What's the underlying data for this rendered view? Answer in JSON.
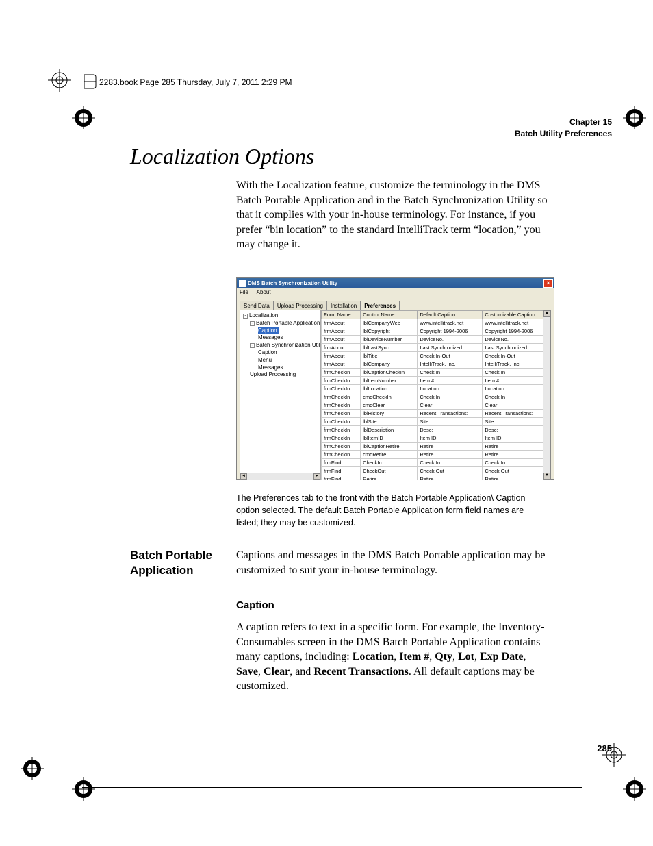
{
  "bookline": "2283.book  Page 285  Thursday, July 7, 2011  2:29 PM",
  "header": {
    "chapter": "Chapter 15",
    "title": "Batch Utility Preferences"
  },
  "h1": "Localization Options",
  "para1": "With the Localization feature, customize the terminology in the DMS Batch Portable Application and in the Batch Synchronization Utility so that it complies with your in-house terminology. For instance, if you prefer “bin location” to the standard IntelliTrack term “location,” you may change it.",
  "app": {
    "title": "DMS Batch Synchronization Utility",
    "menu": [
      "File",
      "About"
    ],
    "tabs": [
      "Send Data",
      "Upload Processing",
      "Installation",
      "Preferences"
    ],
    "active_tab": 3,
    "tree": [
      {
        "lvl": 0,
        "exp": "-",
        "label": "Localization"
      },
      {
        "lvl": 1,
        "exp": "-",
        "label": "Batch Portable Application"
      },
      {
        "lvl": 2,
        "label": "Caption",
        "selected": true
      },
      {
        "lvl": 2,
        "label": "Messages"
      },
      {
        "lvl": 1,
        "exp": "-",
        "label": "Batch Synchronization Utility"
      },
      {
        "lvl": 2,
        "label": "Caption"
      },
      {
        "lvl": 2,
        "label": "Menu"
      },
      {
        "lvl": 2,
        "label": "Messages"
      },
      {
        "lvl": 1,
        "label": "Upload Processing"
      }
    ],
    "columns": [
      "Form Name",
      "Control Name",
      "Default Caption",
      "Customizable Caption"
    ],
    "rows": [
      [
        "frmAbout",
        "lblCompanyWeb",
        "www.intellitrack.net",
        "www.intellitrack.net"
      ],
      [
        "frmAbout",
        "lblCopyright",
        "Copyright 1994-2006",
        "Copyright 1994-2006"
      ],
      [
        "frmAbout",
        "lblDeviceNumber",
        "DeviceNo.",
        "DeviceNo."
      ],
      [
        "frmAbout",
        "lblLastSync",
        "Last Synchronized:",
        "Last Synchronized:"
      ],
      [
        "frmAbout",
        "lblTitle",
        "Check In-Out",
        "Check In-Out"
      ],
      [
        "frmAbout",
        "lblCompany",
        "IntelliTrack, Inc.",
        "IntelliTrack, Inc."
      ],
      [
        "frmCheckIn",
        "lblCaptionCheckIn",
        "Check In",
        "Check In"
      ],
      [
        "frmCheckIn",
        "lblItemNumber",
        "Item #:",
        "Item #:"
      ],
      [
        "frmCheckIn",
        "lblLocation",
        "Location:",
        "Location:"
      ],
      [
        "frmCheckIn",
        "cmdCheckIn",
        "Check In",
        "Check In"
      ],
      [
        "frmCheckIn",
        "cmdClear",
        "Clear",
        "Clear"
      ],
      [
        "frmCheckIn",
        "lblHistory",
        "Recent Transactions:",
        "Recent Transactions:"
      ],
      [
        "frmCheckIn",
        "lblSite",
        "Site:",
        "Site:"
      ],
      [
        "frmCheckIn",
        "lblDescription",
        "Desc:",
        "Desc:"
      ],
      [
        "frmCheckIn",
        "lblItemID",
        "Item ID:",
        "Item ID:"
      ],
      [
        "frmCheckIn",
        "lblCaptionRetire",
        "Retire",
        "Retire"
      ],
      [
        "frmCheckIn",
        "cmdRetire",
        "Retire",
        "Retire"
      ],
      [
        "frmFind",
        "CheckIn",
        "Check In",
        "Check In"
      ],
      [
        "frmFind",
        "CheckOut",
        "Check Out",
        "Check Out"
      ],
      [
        "frmFind",
        "Retire",
        "Retire",
        "Retire"
      ]
    ]
  },
  "caption_note": "The Preferences tab to the front with the Batch Portable Application\\ Caption option selected. The default Batch Portable Application form field names are listed; they may be customized.",
  "side_h": "Batch Portable Application",
  "para2": "Captions and messages in the DMS Batch Portable application may be cus­tomized to suit your in-house terminology.",
  "h3": "Caption",
  "para3_pre": "A caption refers to text in a specific form. For example, the Inventory-Consumables screen in the DMS Batch Portable Application contains many captions, including: ",
  "para3_bold": [
    "Location",
    "Item #",
    "Qty",
    "Lot",
    "Exp Date",
    "Save",
    "Clear",
    "Recent Transactions"
  ],
  "para3_post": ". All default captions may be customized.",
  "pagenum": "285"
}
